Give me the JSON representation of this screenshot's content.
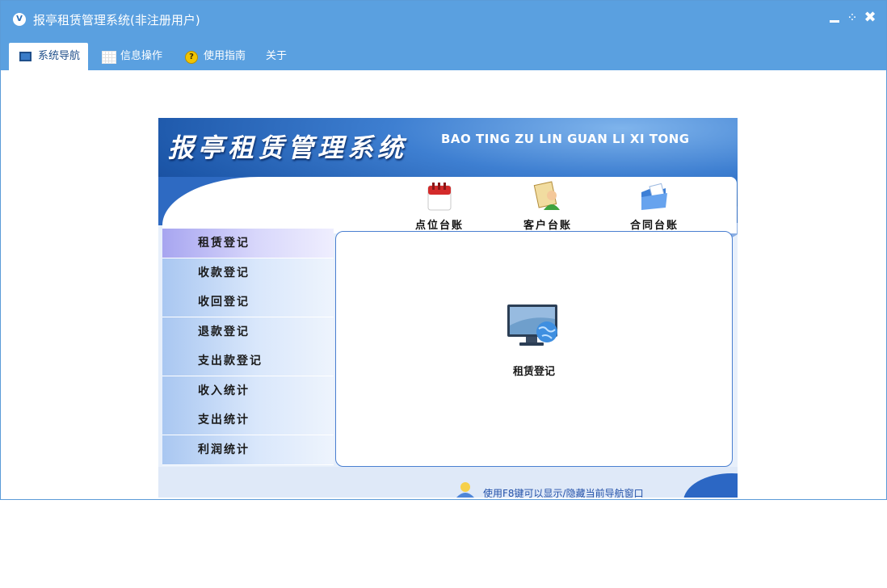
{
  "window": {
    "title": "报亭租赁管理系统(非注册用户)",
    "app_icon_glyph": "V",
    "close_glyph": "✖",
    "restore_glyph": "⁘"
  },
  "menu": {
    "items": [
      {
        "label": "系统导航",
        "icon": "monitor-icon",
        "active": true
      },
      {
        "label": "信息操作",
        "icon": "grid-icon",
        "active": false
      },
      {
        "label": "使用指南",
        "icon": "help-icon",
        "active": false
      },
      {
        "label": "关于",
        "icon": "",
        "active": false
      }
    ],
    "help_glyph": "?"
  },
  "banner": {
    "title": "报亭租赁管理系统",
    "subtitle": "BAO TING ZU LIN GUAN LI XI TONG"
  },
  "quick_links": [
    {
      "label": "点位台账",
      "icon": "calendar-icon"
    },
    {
      "label": "客户台账",
      "icon": "customer-icon"
    },
    {
      "label": "合同台账",
      "icon": "folder-icon"
    }
  ],
  "nav": {
    "items": [
      {
        "label": "租赁登记",
        "active": true
      },
      {
        "label": "收款登记",
        "active": false
      },
      {
        "label": "收回登记",
        "active": false
      },
      {
        "label": "退款登记",
        "active": false
      },
      {
        "label": "支出款登记",
        "active": false
      },
      {
        "label": "收入统计",
        "active": false
      },
      {
        "label": "支出统计",
        "active": false
      },
      {
        "label": "利润统计",
        "active": false
      }
    ]
  },
  "content": {
    "label": "租赁登记",
    "icon": "monitor-globe-icon"
  },
  "footer": {
    "hint": "使用F8键可以显示/隐藏当前导航窗口"
  },
  "colors": {
    "titlebar": "#5aa0e0",
    "accent": "#1f4f8a"
  }
}
